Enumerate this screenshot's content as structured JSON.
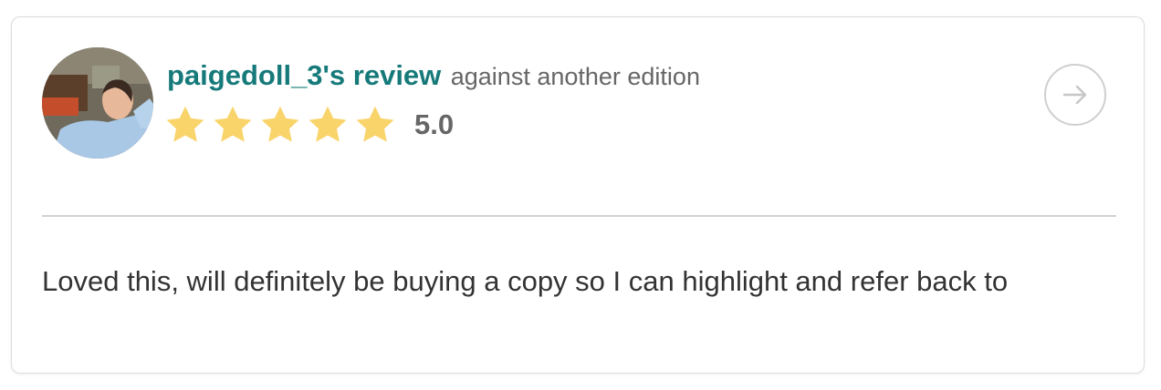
{
  "review": {
    "username_line": "paigedoll_3's review",
    "edition_note": "against another edition",
    "rating": 5,
    "rating_max": 5,
    "rating_label": "5.0",
    "text": "Loved this, will definitely be buying a copy so I can highlight and refer back to"
  },
  "colors": {
    "accent": "#177a7a",
    "star": "#f9d46b",
    "muted": "#666666",
    "border": "#dcdcdc"
  },
  "icons": {
    "next": "arrow-right-icon",
    "star": "star-icon",
    "avatar": "avatar"
  }
}
